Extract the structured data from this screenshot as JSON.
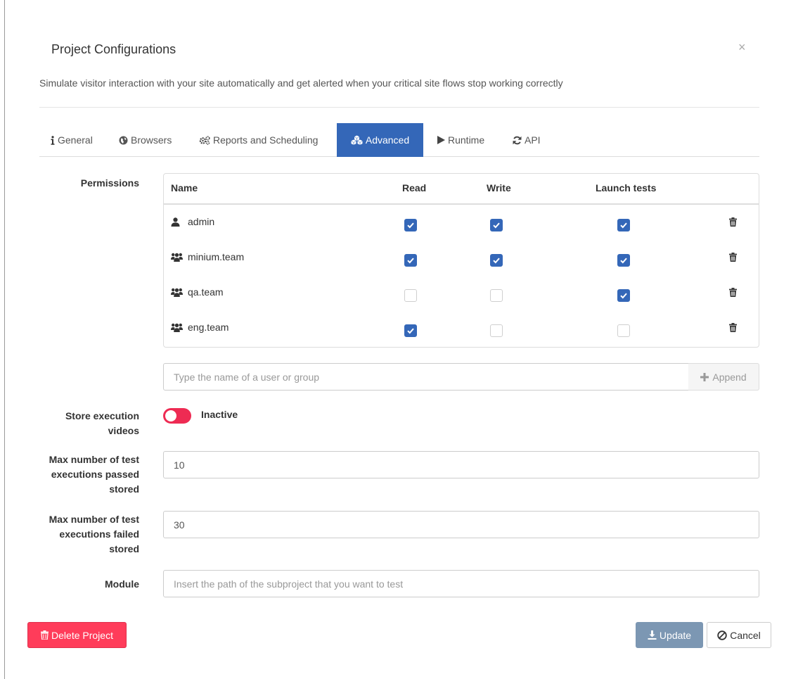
{
  "modal": {
    "title": "Project Configurations",
    "close": "×",
    "subtitle": "Simulate visitor interaction with your site automatically and get alerted when your critical site flows stop working correctly"
  },
  "tabs": [
    {
      "label": "General",
      "icon": "info-icon",
      "active": false
    },
    {
      "label": "Browsers",
      "icon": "globe-icon",
      "active": false
    },
    {
      "label": "Reports and Scheduling",
      "icon": "cogs-icon",
      "active": false
    },
    {
      "label": "Advanced",
      "icon": "cubes-icon",
      "active": true
    },
    {
      "label": "Runtime",
      "icon": "play-icon",
      "active": false
    },
    {
      "label": "API",
      "icon": "refresh-icon",
      "active": false
    }
  ],
  "permissions": {
    "label": "Permissions",
    "columns": {
      "name": "Name",
      "read": "Read",
      "write": "Write",
      "launch": "Launch tests"
    },
    "rows": [
      {
        "name": "admin",
        "type": "user",
        "read": true,
        "write": true,
        "launch": true
      },
      {
        "name": "minium.team",
        "type": "group",
        "read": true,
        "write": true,
        "launch": true
      },
      {
        "name": "qa.team",
        "type": "group",
        "read": false,
        "write": false,
        "launch": true
      },
      {
        "name": "eng.team",
        "type": "group",
        "read": true,
        "write": false,
        "launch": false
      }
    ],
    "add_placeholder": "Type the name of a user or group",
    "append_label": "Append"
  },
  "store_videos": {
    "label_line1": "Store execution",
    "label_line2": "videos",
    "state": "Inactive",
    "toggle_color": "#ee2b53"
  },
  "max_passed": {
    "label_line1": "Max number of test",
    "label_line2": "executions passed",
    "label_line3": "stored",
    "value": "10"
  },
  "max_failed": {
    "label_line1": "Max number of test",
    "label_line2": "executions failed",
    "label_line3": "stored",
    "value": "30"
  },
  "module": {
    "label": "Module",
    "placeholder": "Insert the path of the subproject that you want to test"
  },
  "footer": {
    "delete_label": "Delete Project",
    "update_label": "Update",
    "cancel_label": "Cancel"
  },
  "colors": {
    "accent": "#3467b8",
    "danger": "#ff3c5a",
    "update": "#7c97b3"
  }
}
